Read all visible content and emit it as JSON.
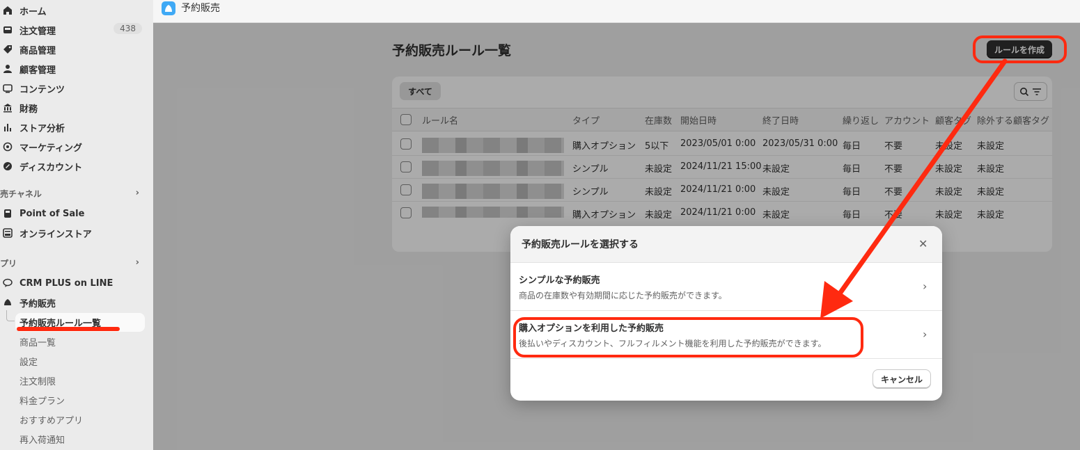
{
  "sidebar": {
    "items": [
      {
        "label": "ホーム",
        "icon": "home-icon"
      },
      {
        "label": "注文管理",
        "icon": "inbox-icon",
        "badge": "438"
      },
      {
        "label": "商品管理",
        "icon": "tag-icon"
      },
      {
        "label": "顧客管理",
        "icon": "person-icon"
      },
      {
        "label": "コンテンツ",
        "icon": "content-icon"
      },
      {
        "label": "財務",
        "icon": "bank-icon"
      },
      {
        "label": "ストア分析",
        "icon": "bar-chart-icon"
      },
      {
        "label": "マーケティング",
        "icon": "target-icon"
      },
      {
        "label": "ディスカウント",
        "icon": "discount-icon"
      }
    ],
    "sales_channels": {
      "heading": "売チャネル",
      "items": [
        {
          "label": "Point of Sale",
          "icon": "pos-icon"
        },
        {
          "label": "オンラインストア",
          "icon": "store-icon"
        }
      ]
    },
    "apps": {
      "heading": "プリ",
      "items": [
        {
          "label": "CRM PLUS on LINE",
          "icon": "chat-bubble-icon"
        },
        {
          "label": "予約販売",
          "icon": "app-logo-icon"
        }
      ],
      "sub_items": [
        "予約販売ルール一覧",
        "商品一覧",
        "設定",
        "注文制限",
        "料金プラン",
        "おすすめアプリ",
        "再入荷通知"
      ]
    }
  },
  "appbar": {
    "title": "予約販売"
  },
  "main": {
    "page_title": "予約販売ルール一覧",
    "create_button": "ルールを作成",
    "tab_all": "すべて",
    "table": {
      "headers": [
        "ルール名",
        "タイプ",
        "在庫数",
        "開始日時",
        "終了日時",
        "繰り返し",
        "アカウント",
        "顧客タグ",
        "除外する顧客タグ"
      ],
      "rows": [
        {
          "type": "購入オプション",
          "stock": "5以下",
          "start": "2023/05/01 0:00",
          "end": "2023/05/31 0:00",
          "repeat": "毎日",
          "account": "不要",
          "tag": "未設定",
          "exclude": "未設定"
        },
        {
          "type": "シンプル",
          "stock": "未設定",
          "start": "2024/11/21 15:00",
          "end": "未設定",
          "repeat": "毎日",
          "account": "不要",
          "tag": "未設定",
          "exclude": "未設定"
        },
        {
          "type": "シンプル",
          "stock": "未設定",
          "start": "2024/11/21 0:00",
          "end": "未設定",
          "repeat": "毎日",
          "account": "不要",
          "tag": "未設定",
          "exclude": "未設定"
        },
        {
          "type": "購入オプション",
          "stock": "未設定",
          "start": "2024/11/21 0:00",
          "end": "未設定",
          "repeat": "毎日",
          "account": "不要",
          "tag": "未設定",
          "exclude": "未設定"
        }
      ]
    }
  },
  "modal": {
    "title": "予約販売ルールを選択する",
    "options": [
      {
        "title": "シンプルな予約販売",
        "desc": "商品の在庫数や有効期間に応じた予約販売ができます。"
      },
      {
        "title": "購入オプションを利用した予約販売",
        "desc": "後払いやディスカウント、フルフィルメント機能を利用した予約販売ができます。"
      }
    ],
    "cancel": "キャンセル"
  },
  "colors": {
    "annotation": "#ff2a10",
    "primary_button": "#303030",
    "app_logo": "#3fa9f5"
  }
}
